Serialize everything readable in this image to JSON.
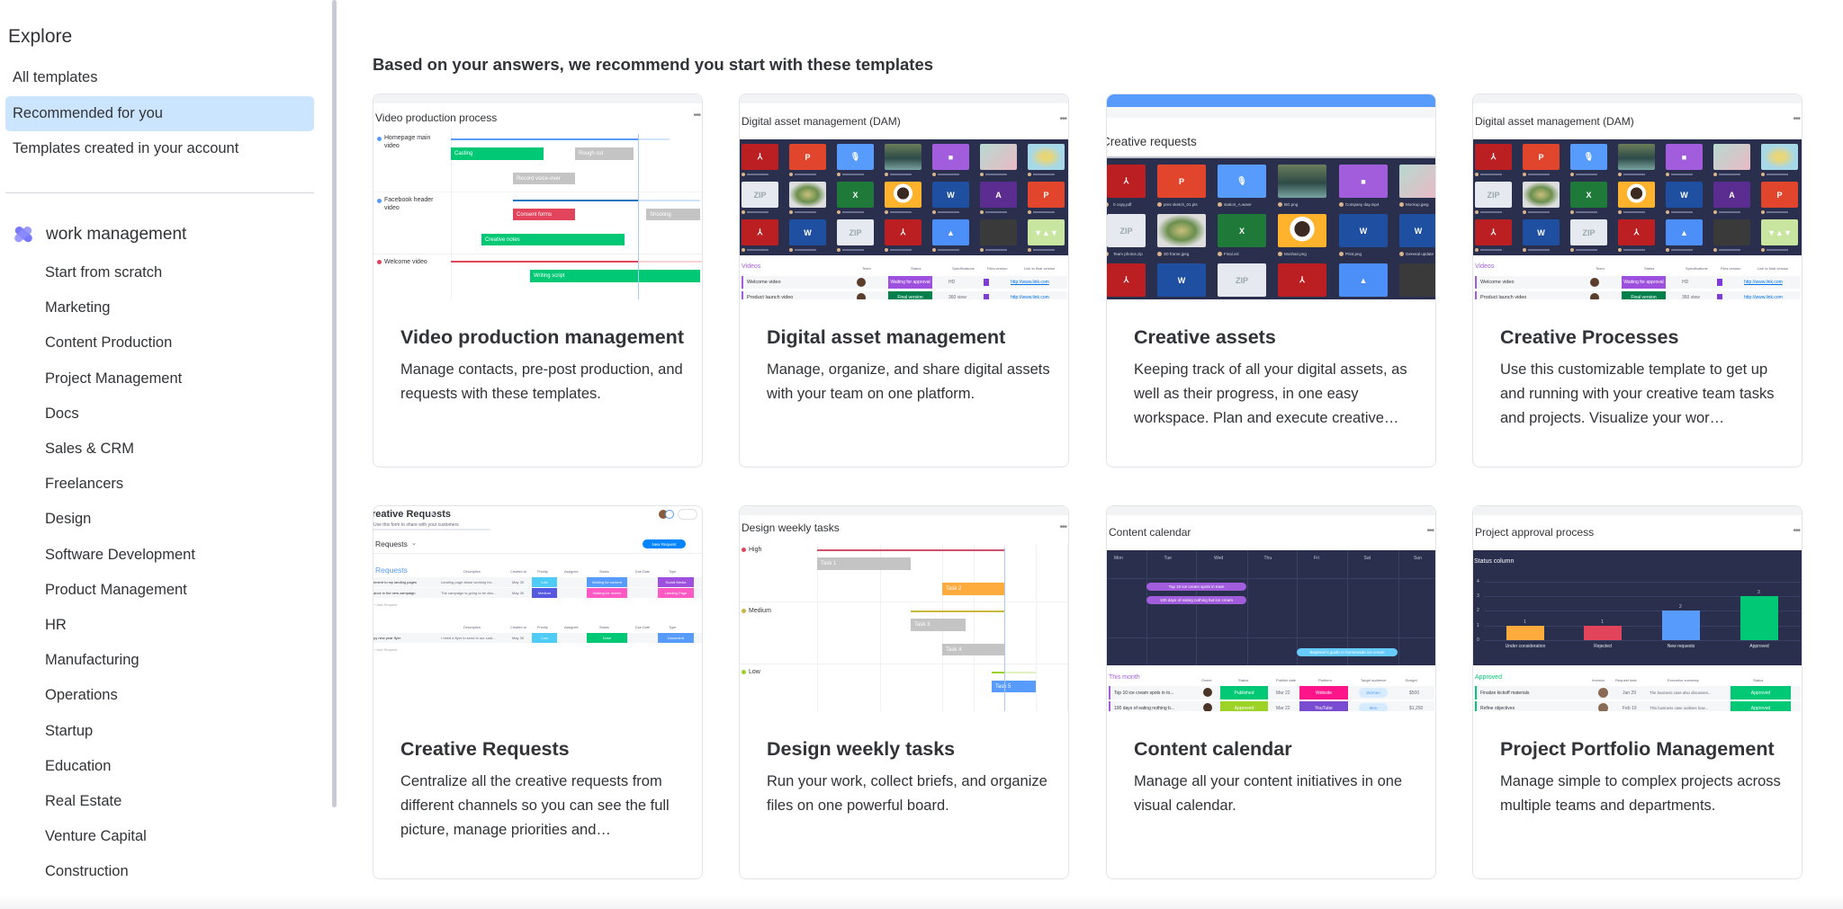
{
  "sidebar": {
    "explore_title": "Explore",
    "links": [
      "All templates",
      "Recommended for you",
      "Templates created in your account"
    ],
    "active_link": "Recommended for you",
    "product": {
      "name": "work management",
      "icon": "monday-work-management-logo"
    },
    "categories": [
      "Start from scratch",
      "Marketing",
      "Content Production",
      "Project Management",
      "Docs",
      "Sales & CRM",
      "Freelancers",
      "Design",
      "Software Development",
      "Product Management",
      "HR",
      "Manufacturing",
      "Operations",
      "Startup",
      "Education",
      "Real Estate",
      "Venture Capital",
      "Construction"
    ]
  },
  "main": {
    "heading": "Based on your answers, we recommend you start with these templates",
    "cards": [
      {
        "title": "Video production management",
        "description": "Manage contacts, pre-post production, and requests with these templates.",
        "preview_title": "Video production process"
      },
      {
        "title": "Digital asset management",
        "description": "Manage, organize, and share digital assets with your team on one platform.",
        "preview_title": "Digital asset management (DAM)"
      },
      {
        "title": "Creative assets",
        "description": "Keeping track of all your digital assets, as well as their progress, in one easy workspace. Plan and execute creative…",
        "preview_title": "Creative requests"
      },
      {
        "title": "Creative Processes",
        "description": "Use this customizable template to get up and running with your creative team tasks and projects. Visualize your wor…",
        "preview_title": "Digital asset management (DAM)"
      },
      {
        "title": "Creative Requests",
        "description": "Centralize all the creative requests from different channels so you can see the full picture, manage priorities and…",
        "preview_title": "Creative Requests"
      },
      {
        "title": "Design weekly tasks",
        "description": "Run your work, collect briefs, and organize files on one powerful board.",
        "preview_title": "Design weekly tasks"
      },
      {
        "title": "Content calendar",
        "description": "Manage all your content initiatives in one visual calendar.",
        "preview_title": "Content calendar"
      },
      {
        "title": "Project Portfolio Management",
        "description": "Manage simple to complex projects across multiple teams and departments.",
        "preview_title": "Project approval process"
      }
    ]
  },
  "video_preview": {
    "rows": [
      "Homepage main video",
      "Facebook header video",
      "Welcome video"
    ],
    "bars": [
      "Casting",
      "Rough cut",
      "Record voice-over",
      "Consent forms",
      "Shooting",
      "Creative notes",
      "Writing script"
    ]
  },
  "dam_preview": {
    "group": "Videos",
    "columns": [
      "Team",
      "Status",
      "Specifications",
      "Files version",
      "Link to final version"
    ],
    "rows": [
      {
        "name": "Welcome video",
        "status": "Waiting for approval",
        "spec": "HD",
        "link": "http://www.link.com"
      },
      {
        "name": "Product launch video",
        "status": "Final version",
        "spec": "360 view",
        "link": "http://www.link.com"
      }
    ],
    "tiles": [
      "pdf",
      "ppt",
      "audio",
      "image-forest",
      "video",
      "image-mint",
      "image-fruit",
      "zip",
      "image-plant",
      "excel",
      "image-portrait",
      "word",
      "premiere",
      "ppt",
      "pdf",
      "word",
      "zip",
      "pdf",
      "drive",
      "image-dark",
      "image-watermelon"
    ]
  },
  "creative_assets_preview": {
    "captions": [
      "0 copy.pdf",
      "pres sketch_01.pts",
      "station_A.wave",
      "BG.png",
      "Company day.mp4",
      "Mockup.jpeg",
      "Team photos.zip",
      "3D frame.jpeg",
      "Final.xsl",
      "Moshari.png",
      "Print.png",
      "General update"
    ]
  },
  "requests_preview": {
    "subtitle": "Use this form to share with your customers",
    "view": "Requests",
    "new_button": "New Request",
    "group": "Requests",
    "columns": [
      "Description",
      "Created at",
      "Priority",
      "Assignee",
      "Status",
      "Due Date",
      "Type"
    ],
    "rows": [
      {
        "name": "ement to my landing pages",
        "desc": "Landing page about working fro...",
        "date": "May 30",
        "priority": "Low",
        "status": "Waiting for content",
        "type": "Social Media"
      },
      {
        "name": "ance in the new campaign",
        "desc": "The campaign is going to be abo...",
        "date": "May 30",
        "priority": "Medium",
        "status": "Waiting for review",
        "type": "Landing Page"
      },
      {
        "name": "py new year flyer",
        "desc": "I need a flyer to send to our cust...",
        "date": "May 30",
        "priority": "Low",
        "status": "Done",
        "type": "Document"
      }
    ],
    "add": "+ Add Request"
  },
  "weekly_preview": {
    "groups": [
      "High",
      "Medium",
      "Low"
    ],
    "tasks": [
      "Task 1",
      "Task 2",
      "Task 3",
      "Task 4",
      "Task 5"
    ]
  },
  "calendar_preview": {
    "days": [
      "Mon",
      "Tue",
      "Wed",
      "Thu",
      "Fri",
      "Sat",
      "Sun"
    ],
    "events": [
      "Top 10 ice cream spots in town",
      "100 days of eating nothing but ice cream",
      "Beginner's guide to homemade ice cream"
    ],
    "group": "This month",
    "columns": [
      "Owner",
      "Status",
      "Publish date",
      "Platform",
      "Target audience",
      "Budget"
    ],
    "rows": [
      {
        "name": "Top 10 ice cream spots in to...",
        "status": "Published",
        "date": "Mar 22",
        "platform": "Website",
        "audience": "Women",
        "budget": "$500"
      },
      {
        "name": "100 days of eating nothing b...",
        "status": "Approved",
        "date": "Mar 22",
        "platform": "YouTube",
        "audience": "Men",
        "budget": "$1,250"
      }
    ]
  },
  "approval_preview": {
    "chart_title": "Status column",
    "chart_data": {
      "type": "bar",
      "categories": [
        "Under consideration",
        "Rejected",
        "New requests",
        "Approved"
      ],
      "values": [
        1,
        1,
        2,
        3
      ],
      "ylim": [
        0,
        4
      ],
      "yticks": [
        "0",
        "1",
        "2",
        "3",
        "4"
      ],
      "colors": [
        "#fdab3d",
        "#e2445c",
        "#579bfc",
        "#00c875"
      ]
    },
    "group": "Approved",
    "columns": [
      "Investor",
      "Request date",
      "Executive summary",
      "Status"
    ],
    "rows": [
      {
        "name": "Finalize kickoff materials",
        "date": "Jan 29",
        "summary": "The business case also discusses...",
        "status": "Approved"
      },
      {
        "name": "Refine objectives",
        "date": "Feb 19",
        "summary": "This business case outlines how...",
        "status": "Approved"
      }
    ]
  },
  "colors": {
    "active_bg": "#cce5ff",
    "dark_panel": "#292f4c",
    "green": "#00c875",
    "blue": "#579bfc",
    "orange": "#fdab3d",
    "red": "#e2445c",
    "purple": "#a25ddc"
  }
}
